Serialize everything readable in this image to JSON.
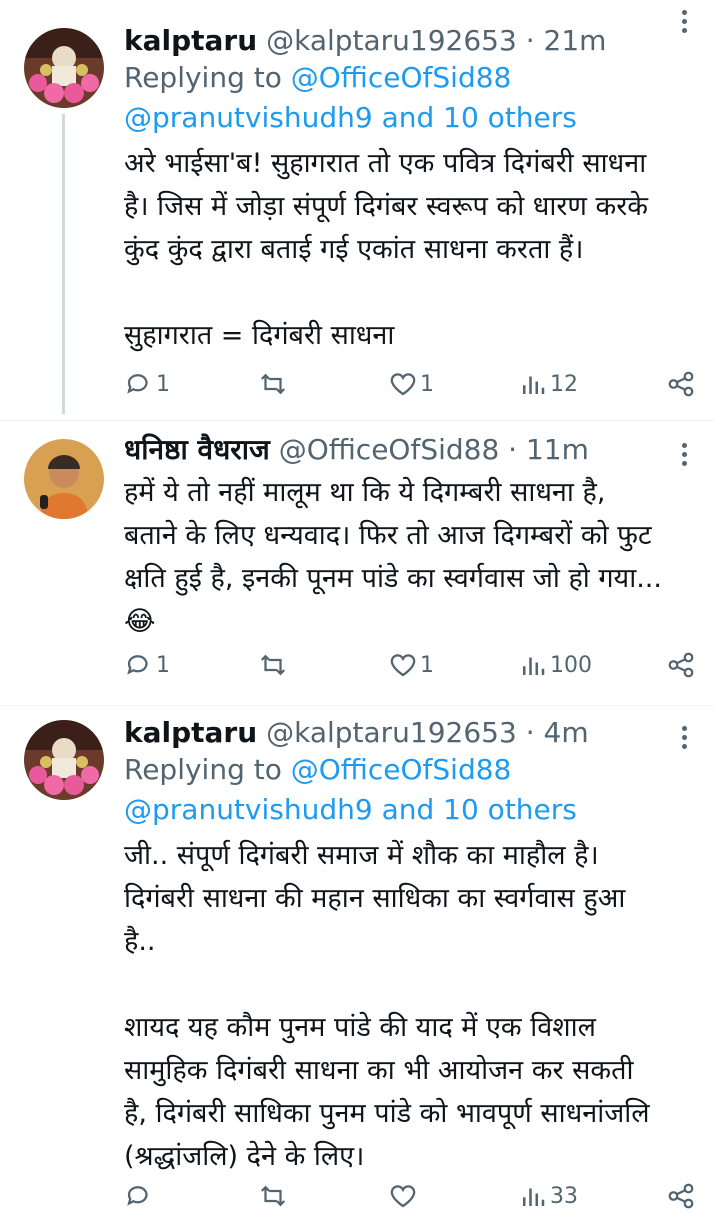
{
  "tweets": [
    {
      "name": "kalptaru",
      "handle": "@kalptaru192653",
      "dot": " · ",
      "time": "21m",
      "replying_prefix": "Replying to ",
      "replying_to": "@OfficeOfSid88",
      "replying_more": "@pranutvishudh9 and 10 others",
      "text": "अरे भाईसा'ब! सुहागरात तो एक पवित्र दिगंबरी साधना\nहै। जिस में जोड़ा संपूर्ण दिगंबर स्वरूप को धारण करके\nकुंद कुंद द्वारा बताई गई एकांत साधना करता हैं।\n\nसुहागरात = दिगंबरी साधना",
      "replies": "1",
      "retweets": "",
      "likes": "1",
      "views": "12"
    },
    {
      "name": "धनिष्ठा वैधराज",
      "handle": "@OfficeOfSid88",
      "dot": " · ",
      "time": "11m",
      "text": "हमें ये तो नहीं मालूम था कि ये दिगम्बरी साधना है,\nबताने के लिए धन्यवाद। फिर तो आज दिगम्बरों को फुट\nक्षति हुई है, इनकी पूनम पांडे का स्वर्गवास जो हो गया...\n😂",
      "replies": "1",
      "retweets": "",
      "likes": "1",
      "views": "100"
    },
    {
      "name": "kalptaru",
      "handle": "@kalptaru192653",
      "dot": " · ",
      "time": "4m",
      "replying_prefix": "Replying to ",
      "replying_to": "@OfficeOfSid88",
      "replying_more": "@pranutvishudh9 and 10 others",
      "text": "जी.. संपूर्ण दिगंबरी समाज में शौक का माहौल है।\nदिगंबरी साधना की महान साधिका का स्वर्गवास हुआ\nहै..\n\nशायद यह कौम पुनम पांडे की याद में एक विशाल\nसामुहिक दिगंबरी साधना का भी आयोजन कर सकती\nहै, दिगंबरी साधिका पुनम पांडे को भावपूर्ण साधनांजलि\n(श्रद्धांजलि) देने के लिए।",
      "replies": "",
      "retweets": "",
      "likes": "",
      "views": "33"
    }
  ],
  "colors": {
    "link": "#1d9bf0",
    "muted": "#536471",
    "text": "#0f1419"
  },
  "icons": [
    "reply-icon",
    "retweet-icon",
    "like-icon",
    "views-icon",
    "share-icon",
    "more-icon"
  ]
}
